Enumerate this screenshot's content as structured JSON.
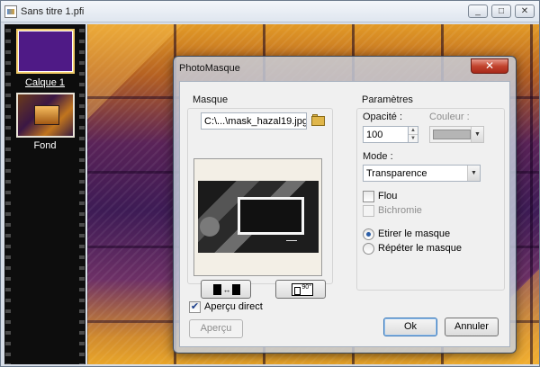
{
  "document": {
    "title": "Sans titre 1.pfi",
    "controls": {
      "minimize": "_",
      "maximize": "□",
      "close": "✕"
    }
  },
  "layers": [
    {
      "label": "Calque 1",
      "selected": true
    },
    {
      "label": "Fond",
      "selected": false
    }
  ],
  "dialog": {
    "title": "PhotoMasque",
    "close_glyph": "✕",
    "masque": {
      "group_label": "Masque",
      "file_path": "C:\\...\\mask_hazal19.jpg",
      "folder_icon": "folder-open-icon",
      "swap_icon": "swap-icon",
      "rotate_icon": "rotate-icon",
      "rotate_label": "90°"
    },
    "parametres": {
      "group_label": "Paramètres",
      "opacity_label": "Opacité :",
      "opacity_value": "100",
      "couleur_label": "Couleur :",
      "couleur_swatch": "#b5b5b5",
      "mode_label": "Mode :",
      "mode_value": "Transparence",
      "flou_label": "Flou",
      "flou_checked": false,
      "bichromie_label": "Bichromie",
      "bichromie_enabled": false,
      "etirer_label": "Etirer le masque",
      "repeter_label": "Répéter le masque",
      "selected_fit": "etirer"
    },
    "apercu_direct_label": "Aperçu direct",
    "apercu_direct_checked": true,
    "buttons": {
      "apercu": "Aperçu",
      "ok": "Ok",
      "annuler": "Annuler"
    }
  }
}
